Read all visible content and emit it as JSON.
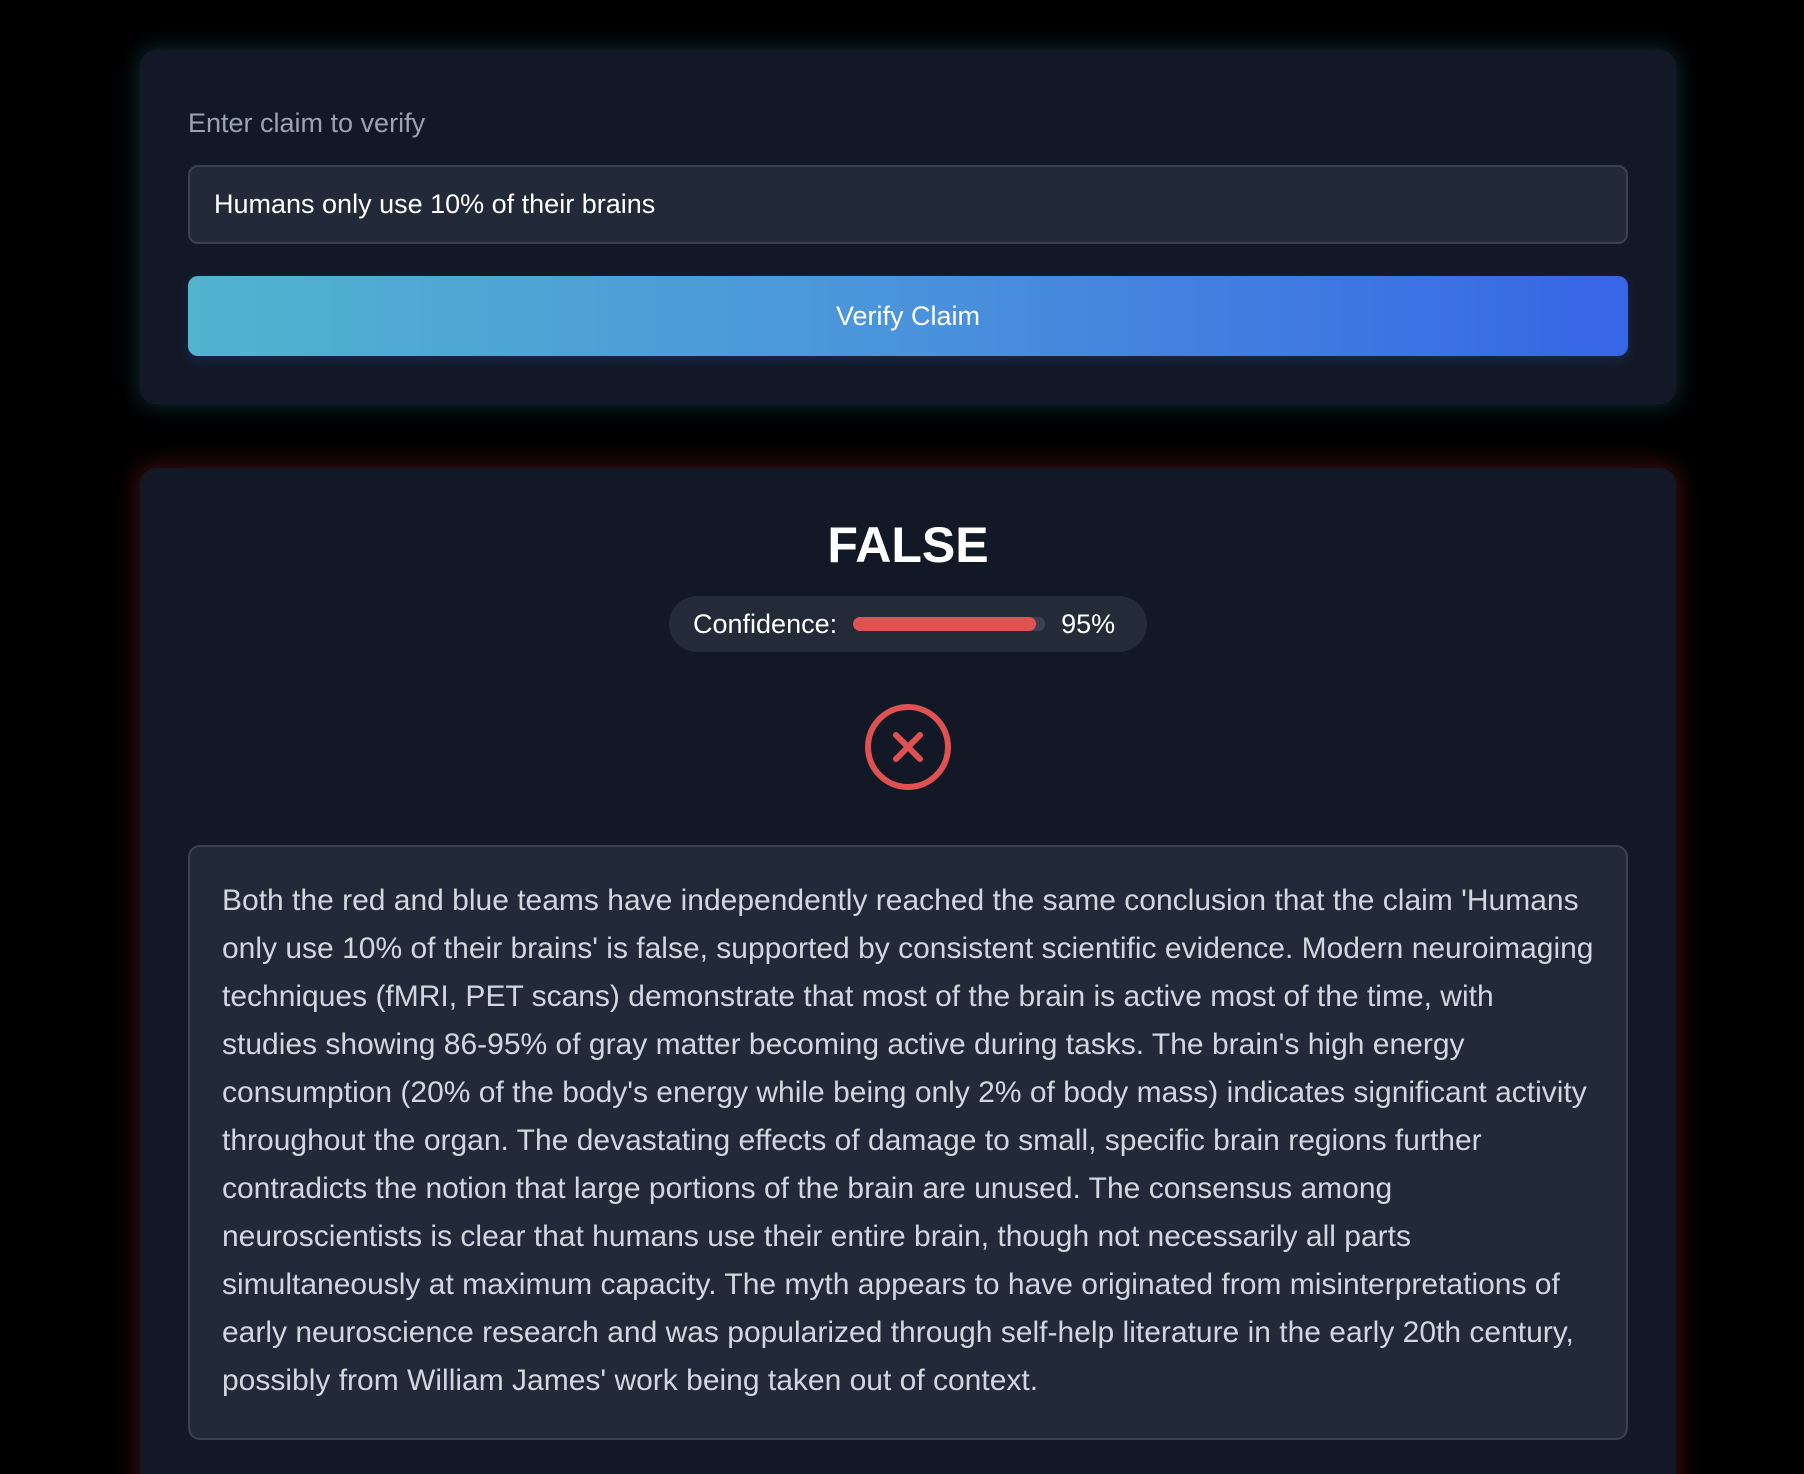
{
  "claim_form": {
    "label": "Enter claim to verify",
    "input_value": "Humans only use 10% of their brains",
    "verify_button_label": "Verify Claim"
  },
  "result": {
    "verdict": "FALSE",
    "confidence_label": "Confidence:",
    "confidence_percent": 95,
    "confidence_text": "95%",
    "verdict_icon": "x-circle-icon",
    "explanation": "Both the red and blue teams have independently reached the same conclusion that the claim 'Humans only use 10% of their brains' is false, supported by consistent scientific evidence. Modern neuroimaging techniques (fMRI, PET scans) demonstrate that most of the brain is active most of the time, with studies showing 86-95% of gray matter becoming active during tasks. The brain's high energy consumption (20% of the body's energy while being only 2% of body mass) indicates significant activity throughout the organ. The devastating effects of damage to small, specific brain regions further contradicts the notion that large portions of the brain are unused. The consensus among neuroscientists is clear that humans use their entire brain, though not necessarily all parts simultaneously at maximum capacity. The myth appears to have originated from misinterpretations of early neuroscience research and was popularized through self-help literature in the early 20th century, possibly from William James' work being taken out of context."
  },
  "colors": {
    "false_red": "#e05252",
    "card_background": "#121826",
    "button_gradient_start": "#52b4cf",
    "button_gradient_end": "#3765e6"
  }
}
